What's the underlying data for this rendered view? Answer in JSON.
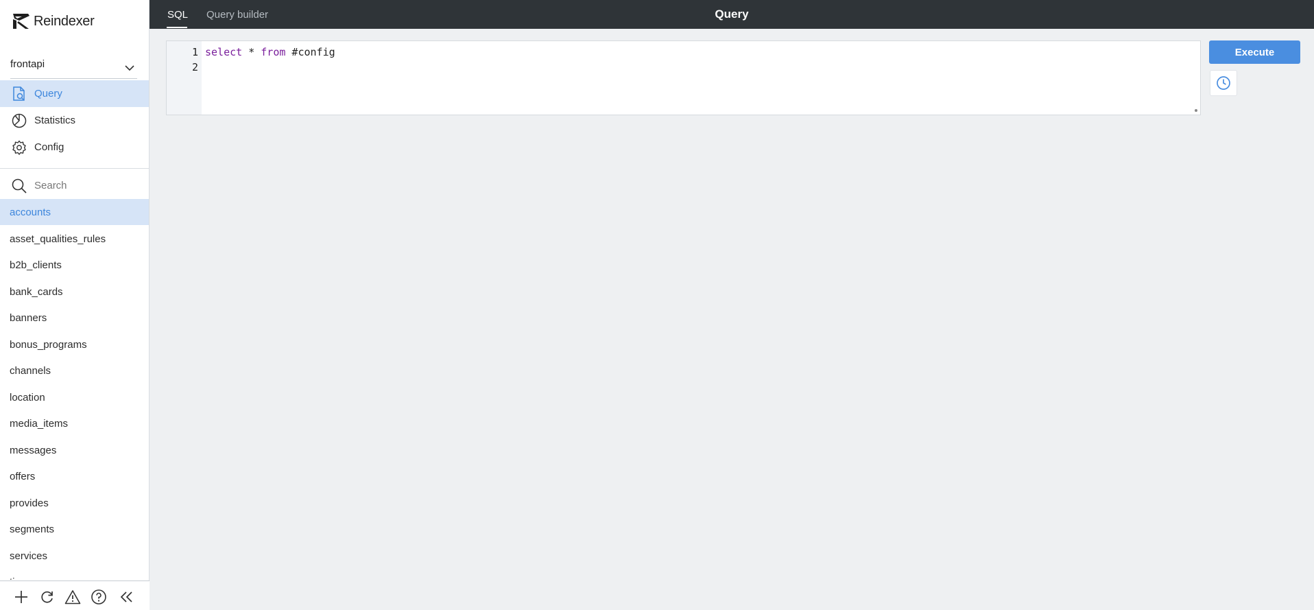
{
  "app": {
    "name": "Reindexer"
  },
  "database": {
    "selected": "frontapi"
  },
  "nav": {
    "items": [
      {
        "label": "Query",
        "icon": "query-icon",
        "active": true
      },
      {
        "label": "Statistics",
        "icon": "statistics-icon",
        "active": false
      },
      {
        "label": "Config",
        "icon": "gear-icon",
        "active": false
      }
    ]
  },
  "search": {
    "placeholder": "Search"
  },
  "namespaces": [
    "accounts",
    "asset_qualities_rules",
    "b2b_clients",
    "bank_cards",
    "banners",
    "bonus_programs",
    "channels",
    "location",
    "media_items",
    "messages",
    "offers",
    "provides",
    "segments",
    "services",
    "ti"
  ],
  "active_namespace": "accounts",
  "header": {
    "tabs": [
      {
        "label": "SQL",
        "active": true
      },
      {
        "label": "Query builder",
        "active": false
      }
    ],
    "title": "Query"
  },
  "editor": {
    "line_numbers": [
      "1",
      "2"
    ],
    "lines": [
      [
        {
          "text": "select",
          "kind": "keyword"
        },
        {
          "text": " * ",
          "kind": "plain"
        },
        {
          "text": "from",
          "kind": "keyword"
        },
        {
          "text": " #config",
          "kind": "plain"
        }
      ],
      []
    ]
  },
  "actions": {
    "execute_label": "Execute",
    "history_icon": "clock-icon"
  },
  "footer": {
    "icons": [
      "plus-icon",
      "refresh-icon",
      "warning-icon",
      "help-icon",
      "collapse-icon"
    ]
  },
  "colors": {
    "accent": "#4a8ee0",
    "active_bg": "#d6e4f7",
    "active_text": "#3d86dc",
    "header_bg": "#2f3438",
    "keyword": "#7a1f9c"
  }
}
